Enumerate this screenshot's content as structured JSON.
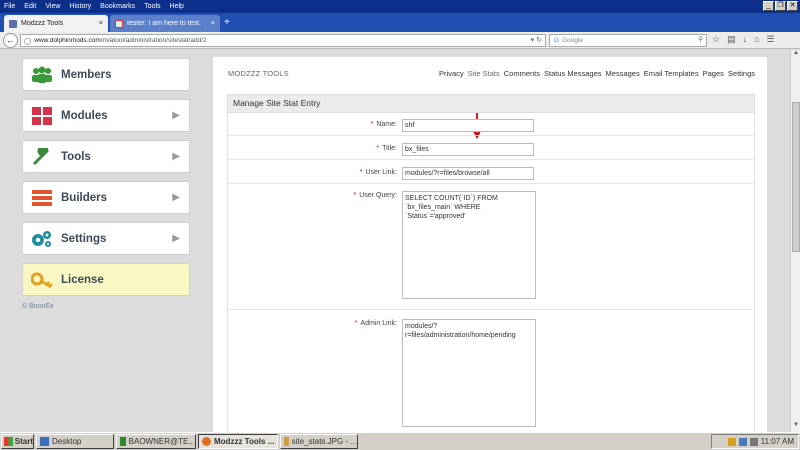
{
  "browser": {
    "menu": [
      "File",
      "Edit",
      "View",
      "History",
      "Bookmarks",
      "Tools",
      "Help"
    ],
    "window_controls": [
      "_",
      "❐",
      "✕"
    ],
    "tabs": [
      {
        "title": "Modzzz Tools",
        "close": "×"
      },
      {
        "title": "tester: I am here to test.",
        "close": "×"
      }
    ],
    "new_tab": "+",
    "url_host": "www.dolphinmods.com",
    "url_path": "/m/atool/administration/sitestat/add/2",
    "search_placeholder": "Google",
    "search_engine_icon": "google-icon",
    "nav_icons": [
      "star-icon",
      "clipboard-icon",
      "download-icon",
      "home-icon",
      "menu-icon"
    ]
  },
  "sidebar": {
    "items": [
      {
        "label": "Members",
        "icon": "members-icon",
        "color": "#3a9a3a",
        "has_chevron": false
      },
      {
        "label": "Modules",
        "icon": "modules-icon",
        "color": "#d4334a",
        "has_chevron": true
      },
      {
        "label": "Tools",
        "icon": "wrench-icon",
        "color": "#3a8a3a",
        "has_chevron": true
      },
      {
        "label": "Builders",
        "icon": "builders-icon",
        "color": "#e0552b",
        "has_chevron": true
      },
      {
        "label": "Settings",
        "icon": "gears-icon",
        "color": "#1f8fa0",
        "has_chevron": true
      },
      {
        "label": "License",
        "icon": "key-icon",
        "color": "#e0a020",
        "has_chevron": false
      }
    ],
    "footer": "© BoonEx"
  },
  "panel": {
    "brand": "MODZZZ TOOLS",
    "nav": [
      "Privacy",
      "Site Stats",
      "Comments",
      "Status Messages",
      "Messages",
      "Email Templates",
      "Pages",
      "Settings"
    ],
    "form_title": "Manage Site Stat Entry",
    "fields": [
      {
        "label": "Name",
        "value": "shf"
      },
      {
        "label": "Title",
        "value": "bx_files"
      },
      {
        "label": "User Link",
        "value": "modules/?r=files/browse/all"
      },
      {
        "label": "User Query",
        "value": "SELECT COUNT(`ID`) FROM `bx_files_main` WHERE `Status`='approved'"
      },
      {
        "label": "Admin Link",
        "value": "modules/?r=files/administration/home/pending"
      }
    ],
    "required_mark": "*",
    "label_suffix": ":"
  },
  "taskbar": {
    "start": "Start",
    "tasks": [
      "Desktop",
      "BAOWNER@TE...",
      "Modzzz Tools ...",
      "site_stats.JPG - ..."
    ],
    "clock": "11:07 AM"
  },
  "colors": {
    "annotation_arrow": "#cc0000",
    "title_bar": "#0b2f8a"
  }
}
